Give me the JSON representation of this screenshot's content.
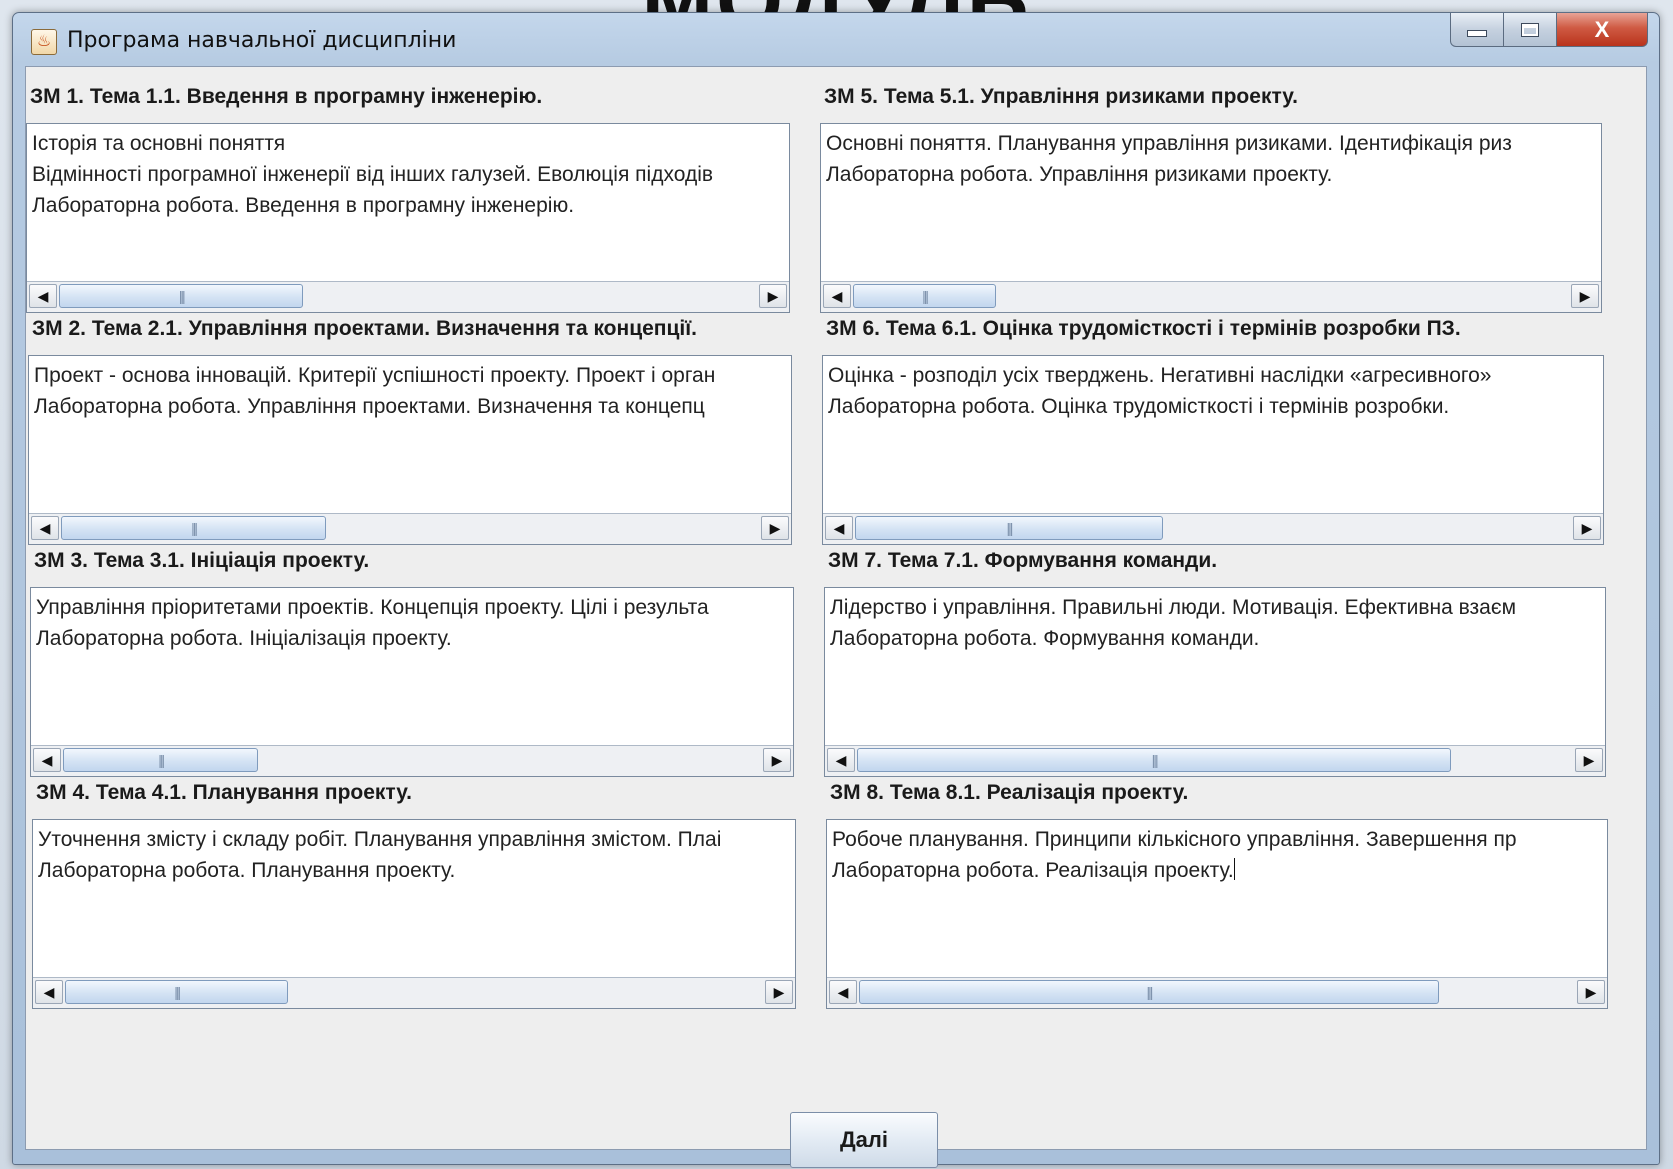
{
  "background": {
    "heading": "МОДУЛЬ"
  },
  "window": {
    "title": "Програма навчальної дисципліни",
    "close_label": "X"
  },
  "sections": [
    {
      "title": "ЗМ 1. Тема 1.1. Введення в програмну інженерію.",
      "lines": [
        "Історія та основні поняття",
        "Відмінності програмної інженерії від інших галузей. Еволюція підходів",
        "Лабораторна робота. Введення в програмну інженерію."
      ],
      "scroll_pct": 35
    },
    {
      "title": "ЗМ 2. Тема 2.1. Управління проектами. Визначення та концепції.",
      "lines": [
        "Проект - основа інновацій. Критерії успішності проекту. Проект і орган",
        "Лабораторна робота. Управління проектами. Визначення та концепц"
      ],
      "scroll_pct": 38
    },
    {
      "title": "ЗМ 3. Тема 3.1. Ініціація проекту.",
      "lines": [
        "Управління пріоритетами проектів. Концепція проекту. Цілі і результа",
        "Лабораторна робота. Ініціалізація проекту."
      ],
      "scroll_pct": 28
    },
    {
      "title": "ЗМ 4. Тема 4.1. Планування проекту.",
      "lines": [
        "Уточнення змісту і складу робіт. Планування управління змістом. Плаі",
        "Лабораторна робота. Планування проекту."
      ],
      "scroll_pct": 32
    },
    {
      "title": "ЗМ 5. Тема 5.1. Управління ризиками проекту.",
      "lines": [
        "Основні поняття. Планування управління ризиками. Ідентифікація риз",
        "Лабораторна робота. Управління ризиками проекту."
      ],
      "scroll_pct": 20
    },
    {
      "title": "ЗМ 6. Тема 6.1. Оцінка трудомісткості і термінів розробки ПЗ.",
      "lines": [
        "Оцінка - розподіл усіх тверджень. Негативні наслідки «агресивного»",
        "Лабораторна робота. Оцінка трудомісткості і термінів розробки."
      ],
      "scroll_pct": 43
    },
    {
      "title": "ЗМ 7. Тема 7.1. Формування команди.",
      "lines": [
        "Лідерство і управління. Правильні люди. Мотивація. Ефективна взаєм",
        "Лабораторна робота. Формування команди."
      ],
      "scroll_pct": 83
    },
    {
      "title": "ЗМ 8. Тема 8.1. Реалізація проекту.",
      "lines": [
        "Робоче планування. Принципи кількісного управління. Завершення пр",
        "Лабораторна робота. Реалізація проекту."
      ],
      "scroll_pct": 81
    }
  ],
  "footer": {
    "next_label": "Далі"
  }
}
